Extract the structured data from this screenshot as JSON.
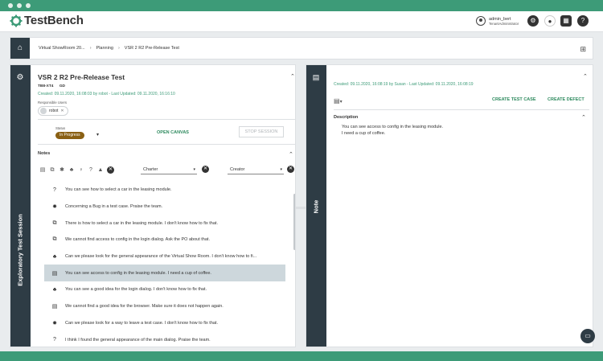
{
  "header": {
    "brand": "TestBench",
    "user_name": "admin_bert",
    "user_role": "TenantAdministrator"
  },
  "breadcrumb": [
    "Virtual ShowRoom 20...",
    "Planning",
    "VSR 2 R2 Pre-Release Test"
  ],
  "left_panel": {
    "strip_label": "Exploratory Test Session",
    "title": "VSR 2 R2 Pre-Release Test",
    "meta_id": "TB8-XT4",
    "meta_code": "GD",
    "created_prefix": "Created: 09.11.2020, 16:08:03 by",
    "created_by": "robot",
    "updated": "- Last Updated: 09.11.2020, 16:16:10",
    "responsible_label": "Responsible Users",
    "responsible_user": "robot",
    "status_label": "Status",
    "status_value": "In Progress",
    "open_canvas": "OPEN CANVAS",
    "stop_session": "STOP SESSION",
    "notes_label": "Notes",
    "charter_placeholder": "Charter",
    "creator_placeholder": "Creator",
    "notes": [
      {
        "icon": "question-icon",
        "text": "You can see how to select a car in the leasing module."
      },
      {
        "icon": "bug-icon",
        "text": "Concerning a Bug in a test case. Praise the team."
      },
      {
        "icon": "puzzle-icon",
        "text": "There is how to select a car in the leasing module. I don't know how to fix that."
      },
      {
        "icon": "puzzle-icon",
        "text": "We cannot find access to config in the login dialog. Ask the PO about that."
      },
      {
        "icon": "thumbs-up-icon",
        "text": "Can we please look for the general appearance of the Virtual Show Room. I don't know how to fi..."
      },
      {
        "icon": "calendar-icon",
        "text": "You can see access to config in the leasing module. I need a cup of coffee."
      },
      {
        "icon": "thumbs-up-icon",
        "text": "You can see a good idea for the login dialog. I don't know how to fix that."
      },
      {
        "icon": "calendar-icon",
        "text": "We cannot find a good idea for the browser. Make sure it does not happen again."
      },
      {
        "icon": "bug-icon",
        "text": "Can we please look for a way to leave a test case. I don't know how to fix that."
      },
      {
        "icon": "question-icon",
        "text": "I think I found the general appearance of the main dialog. Praise the team."
      }
    ],
    "selected_note_index": 5
  },
  "right_panel": {
    "strip_label": "Note",
    "created_prefix": "Created: 09.11.2020, 16:08:19 by",
    "created_by": "Susan",
    "updated": "- Last Updated: 09.11.2020, 16:08:19",
    "create_test_case": "CREATE TEST CASE",
    "create_defect": "CREATE DEFECT",
    "description_label": "Description",
    "description_text": "You can see access to config in the leasing module.\nI need a cup of coffee."
  },
  "colors": {
    "brand_green": "#3d9b78",
    "dark_strip": "#2e3c45",
    "status_brown": "#8a6014",
    "selected_row": "#cdd7dc"
  }
}
